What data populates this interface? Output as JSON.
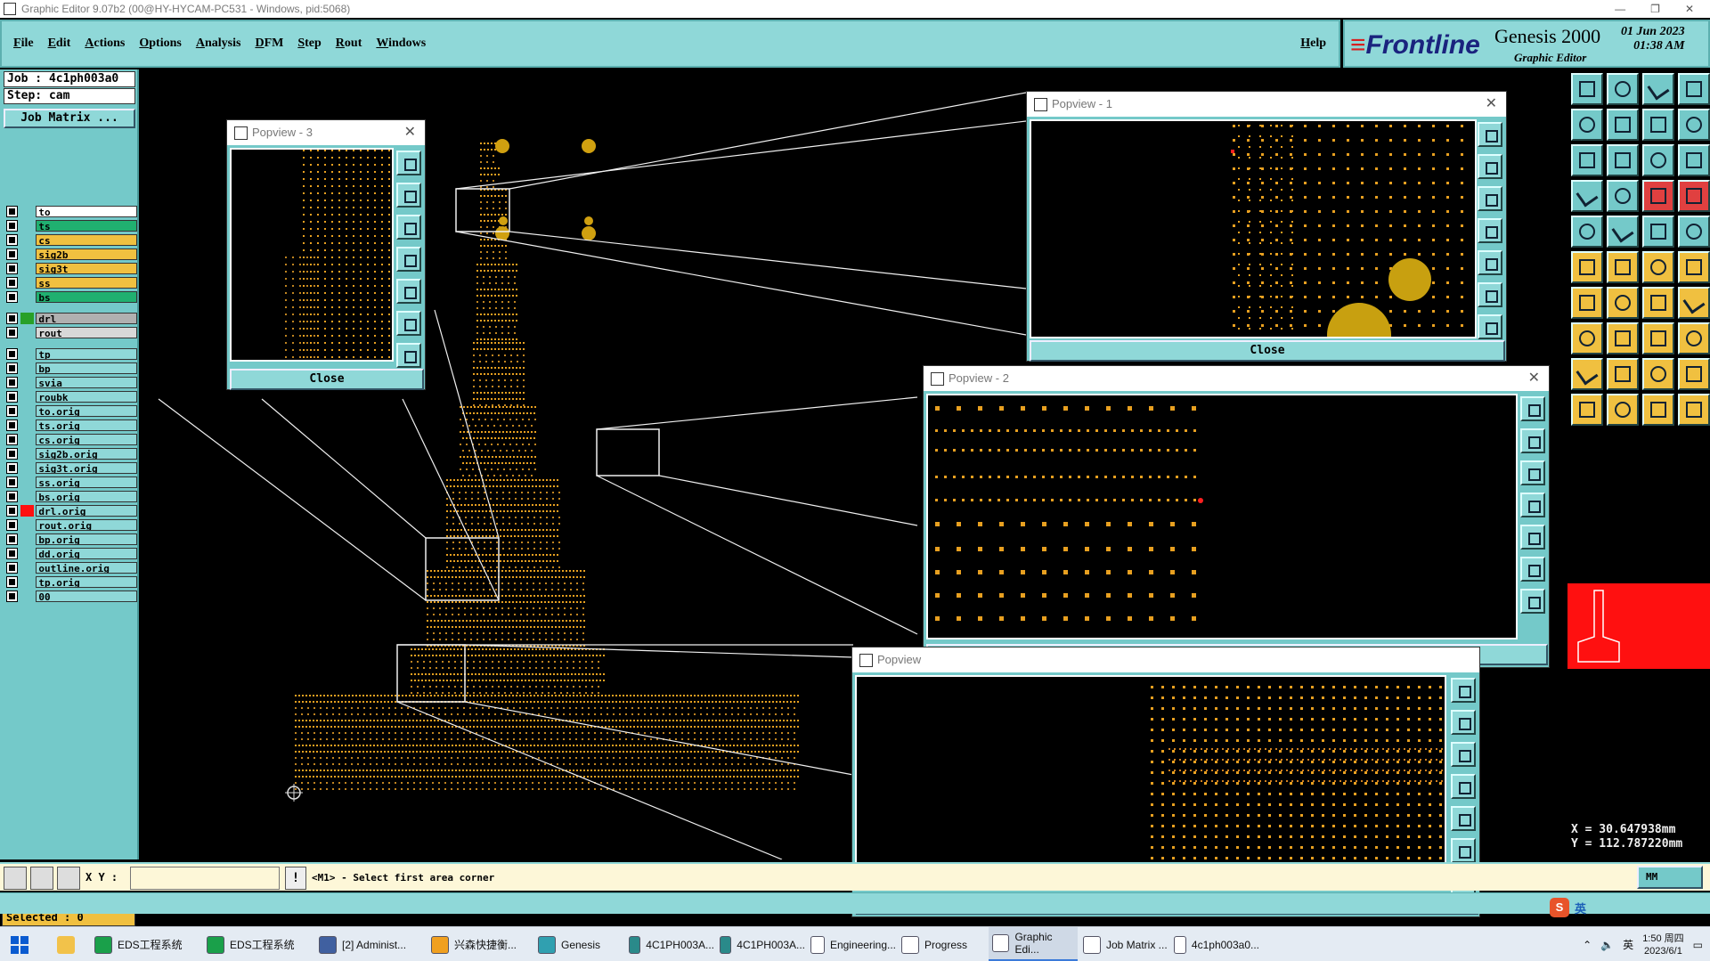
{
  "window": {
    "title": "Graphic Editor 9.07b2 (00@HY-HYCAM-PC531 - Windows, pid:5068)"
  },
  "menu": {
    "items": [
      "File",
      "Edit",
      "Actions",
      "Options",
      "Analysis",
      "DFM",
      "Step",
      "Rout",
      "Windows"
    ],
    "help": "Help"
  },
  "brand": {
    "logo": "Frontline",
    "product": "Genesis 2000",
    "subtitle": "Graphic Editor",
    "date": "01 Jun 2023",
    "time": "01:38 AM"
  },
  "job": {
    "job_label": "Job : 4c1ph003a0",
    "step_label": "Step: cam",
    "matrix_button": "Job Matrix ..."
  },
  "layers": [
    {
      "name": "to",
      "color": "#ffffff",
      "sw": ""
    },
    {
      "name": "ts",
      "color": "#20b070",
      "sw": ""
    },
    {
      "name": "cs",
      "color": "#f0c040",
      "sw": ""
    },
    {
      "name": "sig2b",
      "color": "#f0c040",
      "sw": ""
    },
    {
      "name": "sig3t",
      "color": "#f0c040",
      "sw": ""
    },
    {
      "name": "ss",
      "color": "#f0c040",
      "sw": ""
    },
    {
      "name": "bs",
      "color": "#20b070",
      "sw": ""
    },
    {
      "name": "drl",
      "color": "#b0b0b0",
      "sw": "#28a028"
    },
    {
      "name": "rout",
      "color": "#d8d8d8",
      "sw": ""
    },
    {
      "name": "tp",
      "color": "#8fd8d8",
      "sw": ""
    },
    {
      "name": "bp",
      "color": "#8fd8d8",
      "sw": ""
    },
    {
      "name": "svia",
      "color": "#8fd8d8",
      "sw": ""
    },
    {
      "name": "roubk",
      "color": "#8fd8d8",
      "sw": ""
    },
    {
      "name": "to.orig",
      "color": "#8fd8d8",
      "sw": ""
    },
    {
      "name": "ts.orig",
      "color": "#8fd8d8",
      "sw": ""
    },
    {
      "name": "cs.orig",
      "color": "#8fd8d8",
      "sw": ""
    },
    {
      "name": "sig2b.orig",
      "color": "#8fd8d8",
      "sw": ""
    },
    {
      "name": "sig3t.orig",
      "color": "#8fd8d8",
      "sw": ""
    },
    {
      "name": "ss.orig",
      "color": "#8fd8d8",
      "sw": ""
    },
    {
      "name": "bs.orig",
      "color": "#8fd8d8",
      "sw": ""
    },
    {
      "name": "drl.orig",
      "color": "#8fd8d8",
      "sw": "#ff1010"
    },
    {
      "name": "rout.orig",
      "color": "#8fd8d8",
      "sw": ""
    },
    {
      "name": "bp.orig",
      "color": "#8fd8d8",
      "sw": ""
    },
    {
      "name": "dd.orig",
      "color": "#8fd8d8",
      "sw": ""
    },
    {
      "name": "outline.orig",
      "color": "#8fd8d8",
      "sw": ""
    },
    {
      "name": "tp.orig",
      "color": "#8fd8d8",
      "sw": ""
    },
    {
      "name": "00",
      "color": "#8fd8d8",
      "sw": ""
    }
  ],
  "selected": "Selected : 0",
  "popviews": {
    "p1": "Popview - 1",
    "p2": "Popview - 2",
    "p3": "Popview - 3",
    "p4": "Popview",
    "close": "Close"
  },
  "command": {
    "xy_label": "X Y :",
    "xy_value": "",
    "prompt": "<M1> - Select first area corner",
    "units": "MM"
  },
  "coords": {
    "x": "X = 30.647938mm",
    "y": "Y = 112.787220mm"
  },
  "taskbar": {
    "items": [
      "EDS工程系统",
      "EDS工程系统",
      "[2] Administ...",
      "兴森快捷衡...",
      "Genesis",
      "4C1PH003A...",
      "4C1PH003A...",
      "Engineering...",
      "Progress",
      "Graphic Edi...",
      "Job Matrix ...",
      "4c1ph003a0..."
    ],
    "active": 9,
    "time": "1:50 周四",
    "date": "2023/6/1",
    "ime": "英"
  },
  "colors": {
    "panel": "#74c9c9",
    "pad": "#e8a020",
    "highlight": "#ff1010"
  }
}
